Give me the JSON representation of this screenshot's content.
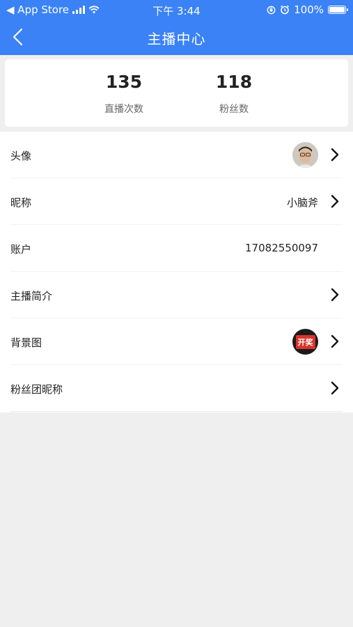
{
  "status_bar": {
    "back_app": "◀ App Store",
    "time": "下午 3:44",
    "battery": "100%"
  },
  "navbar": {
    "title": "主播中心"
  },
  "stats": [
    {
      "value": "135",
      "label": "直播次数"
    },
    {
      "value": "118",
      "label": "粉丝数"
    }
  ],
  "rows": {
    "avatar": {
      "label": "头像"
    },
    "nickname": {
      "label": "昵称",
      "value": "小脑斧"
    },
    "account": {
      "label": "账户",
      "value": "17082550097"
    },
    "intro": {
      "label": "主播简介"
    },
    "background": {
      "label": "背景图",
      "thumb_text": "开奖"
    },
    "fan_group": {
      "label": "粉丝团昵称"
    }
  },
  "colors": {
    "header": "#3a82f6",
    "page_bg": "#efefef"
  }
}
